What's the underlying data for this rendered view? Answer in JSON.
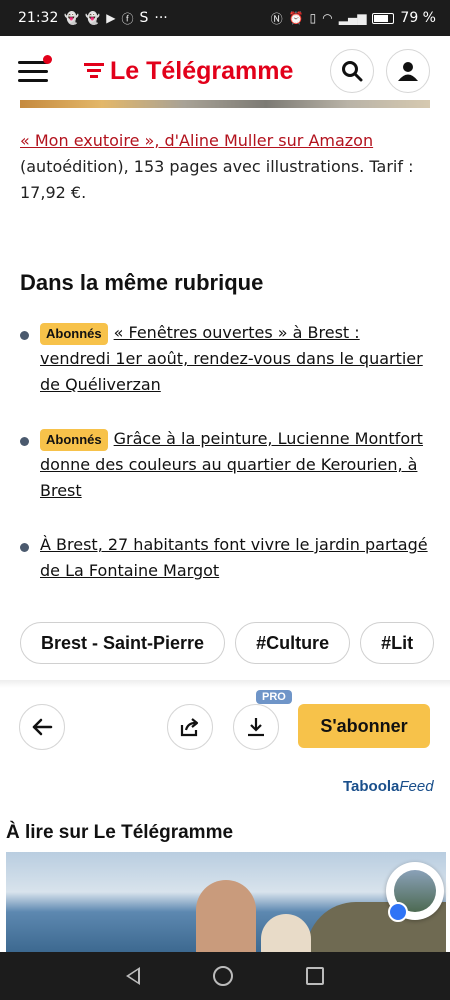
{
  "status_bar": {
    "time": "21:32",
    "carrier_glyph": "S",
    "more": "···",
    "battery": "79 %",
    "icons": [
      "snapchat-icon",
      "snapchat-icon",
      "youtube-icon",
      "facebook-icon",
      "nfc-icon",
      "alarm-icon",
      "vibrate-icon",
      "wifi-icon",
      "signal-icon",
      "battery-icon"
    ]
  },
  "header": {
    "brand": "Le Télégramme",
    "brand_color": "#e2001a",
    "icons": [
      "menu-icon",
      "search-icon",
      "account-icon"
    ]
  },
  "credit": {
    "link_text": "« Mon exutoire », d'Aline Muller sur Amazon",
    "text": " (autoédition), 153 pages avec illustrations. Tarif : 17,92 €."
  },
  "related": {
    "title": "Dans la même rubrique",
    "items": [
      {
        "badge": "Abonnés",
        "text": "« Fenêtres ouvertes » à Brest : vendredi 1er août, rendez-vous dans le quartier de Quéliverzan"
      },
      {
        "badge": "Abonnés",
        "text": "Grâce à la peinture, Lucienne Montfort donne des couleurs au quartier de Kerourien, à Brest"
      },
      {
        "badge": "",
        "text": "À Brest, 27 habitants font vivre le jardin partagé de La Fontaine Margot"
      }
    ]
  },
  "tags": [
    "Brest - Saint-Pierre",
    "#Culture",
    "#Lit"
  ],
  "toolbar": {
    "pro_label": "PRO",
    "subscribe_label": "S'abonner",
    "accent": "#f7c24a",
    "icons": [
      "back-arrow-icon",
      "share-icon",
      "download-icon"
    ]
  },
  "taboola": {
    "brand": "Taboola",
    "feed": "Feed"
  },
  "feed": {
    "title": "À lire sur Le Télégramme"
  }
}
